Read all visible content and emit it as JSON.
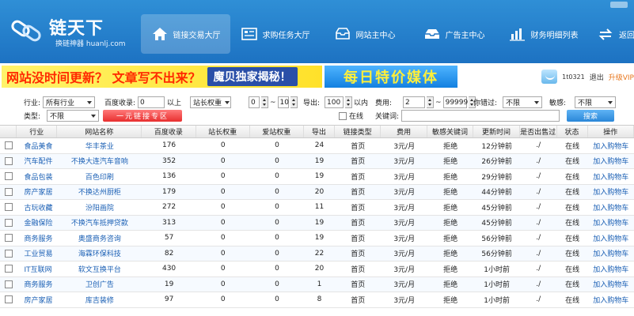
{
  "colors": {
    "header_bg": "#1d72c2",
    "link": "#1a5fb4",
    "special_btn": "#e82f2f",
    "search_btn": "#2a86d8",
    "upgrade": "#e8761c"
  },
  "logo": {
    "title": "链天下",
    "subtitle": "换链神器 huanlj.com",
    "icon": "chain-link-icon"
  },
  "nav": [
    {
      "label": "链接交易大厅",
      "icon": "home-icon",
      "active": true
    },
    {
      "label": "求购任务大厅",
      "icon": "list-board-icon",
      "active": false
    },
    {
      "label": "网站主中心",
      "icon": "inbox-icon",
      "active": false
    },
    {
      "label": "广告主中心",
      "icon": "tray-icon",
      "active": false
    },
    {
      "label": "财务明细列表",
      "icon": "bar-chart-icon",
      "active": false
    },
    {
      "label": "返回",
      "icon": "return-arrows-icon",
      "active": false
    }
  ],
  "banner": {
    "ad1_text": "网站没时间更新？ 文章写不出来？",
    "ad1_badge": "魔贝独家揭秘！",
    "ad2_text": "每日特价媒体"
  },
  "user": {
    "id": "1t0321",
    "logout": "退出",
    "upgrade": "升级VIP"
  },
  "filters": {
    "industry_label": "行业:",
    "industry_value": "所有行业",
    "type_label": "类型:",
    "type_value": "不限",
    "baidu_label": "百度收录:",
    "baidu_value": "0",
    "baidu_suffix": "以上",
    "weight_select": "站长权重",
    "weight_from": "0",
    "weight_sep": "~",
    "weight_to": "10",
    "outbound_label": "导出:",
    "outbound_value": "100",
    "outbound_suffix": "以内",
    "price_label": "费用:",
    "price_from": "2",
    "price_sep": "~",
    "price_to": "99999",
    "expired_label": "你错过:",
    "expired_value": "不限",
    "sensitive_label": "敏感:",
    "sensitive_value": "不限",
    "special_button": "一元链接专区",
    "online_label": "在线",
    "keyword_label": "关键词:",
    "search_button": "搜索"
  },
  "table": {
    "headers": [
      "行业",
      "网站名称",
      "百度收录",
      "站长权重",
      "爱站权重",
      "导出",
      "链接类型",
      "费用",
      "敏感关键词",
      "更新时间",
      "是否出售过",
      "状态",
      "操作"
    ],
    "rows": [
      [
        "食品美食",
        "华丰茶业",
        "176",
        "0",
        "0",
        "24",
        "首页",
        "3元/月",
        "拒绝",
        "12分钟前",
        "./",
        "在线",
        "加入购物车"
      ],
      [
        "汽车配件",
        "不换大连汽车音响",
        "352",
        "0",
        "0",
        "19",
        "首页",
        "3元/月",
        "拒绝",
        "26分钟前",
        "./",
        "在线",
        "加入购物车"
      ],
      [
        "食品包装",
        "百色印刷",
        "136",
        "0",
        "0",
        "19",
        "首页",
        "3元/月",
        "拒绝",
        "29分钟前",
        "./",
        "在线",
        "加入购物车"
      ],
      [
        "房产家居",
        "不换达州厨柜",
        "179",
        "0",
        "0",
        "20",
        "首页",
        "3元/月",
        "拒绝",
        "44分钟前",
        "./",
        "在线",
        "加入购物车"
      ],
      [
        "古玩收藏",
        "汾阳画院",
        "272",
        "0",
        "0",
        "11",
        "首页",
        "3元/月",
        "拒绝",
        "45分钟前",
        "./",
        "在线",
        "加入购物车"
      ],
      [
        "金融保险",
        "不换汽车抵押贷款",
        "313",
        "0",
        "0",
        "19",
        "首页",
        "3元/月",
        "拒绝",
        "45分钟前",
        "./",
        "在线",
        "加入购物车"
      ],
      [
        "商务服务",
        "奥盛商务咨询",
        "57",
        "0",
        "0",
        "19",
        "首页",
        "3元/月",
        "拒绝",
        "56分钟前",
        "./",
        "在线",
        "加入购物车"
      ],
      [
        "工业贸易",
        "海霖环保科技",
        "82",
        "0",
        "0",
        "22",
        "首页",
        "3元/月",
        "拒绝",
        "56分钟前",
        "./",
        "在线",
        "加入购物车"
      ],
      [
        "IT互联网",
        "软文互换平台",
        "430",
        "0",
        "0",
        "20",
        "首页",
        "3元/月",
        "拒绝",
        "1小时前",
        "./",
        "在线",
        "加入购物车"
      ],
      [
        "商务服务",
        "卫创广告",
        "19",
        "0",
        "0",
        "1",
        "首页",
        "3元/月",
        "拒绝",
        "1小时前",
        "./",
        "在线",
        "加入购物车"
      ],
      [
        "房产家居",
        "库吉装修",
        "97",
        "0",
        "0",
        "8",
        "首页",
        "3元/月",
        "拒绝",
        "1小时前",
        "./",
        "在线",
        "加入购物车"
      ]
    ]
  }
}
